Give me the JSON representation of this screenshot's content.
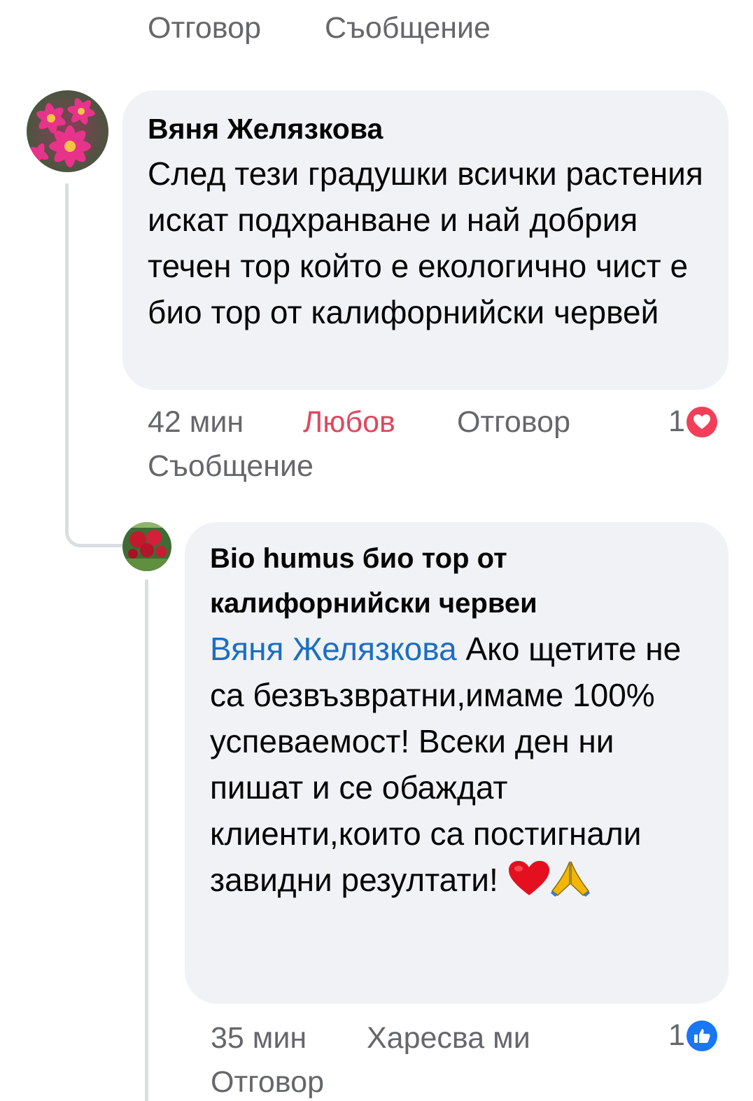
{
  "top_actions": {
    "reply": "Отговор",
    "message": "Съобщение"
  },
  "comment1": {
    "author": "Вяня Желязкова",
    "text": "След тези градушки всички растения искат подхранване и най добрия течен тор който е екологично чист е био тор от калифорнийски червей",
    "time": "42 мин",
    "reaction_label": "Любов",
    "reply": "Отговор",
    "message": "Съобщение",
    "reaction_count": "1",
    "reaction_icon": "love-icon",
    "reaction_color": "#f33e58"
  },
  "comment2": {
    "author": "Bio humus био тор от калифорнийски червеи",
    "mention": "Вяня Желязкова",
    "text": " Ако щетите не са безвъзвратни,имаме 100% успеваемост! Всеки ден ни пишат и се обаждат клиенти,които са постигнали завидни резултати! ",
    "emojis": [
      "heart-emoji",
      "praying-hands-emoji"
    ],
    "time": "35 мин",
    "like": "Харесва ми",
    "reply": "Отговор",
    "reaction_count": "1",
    "reaction_icon": "like-icon",
    "reaction_color": "#1877f2"
  },
  "colors": {
    "bubble": "#f0f2f5",
    "meta_text": "#65676b",
    "love_text": "#e0475f",
    "mention": "#1b6ec2"
  }
}
